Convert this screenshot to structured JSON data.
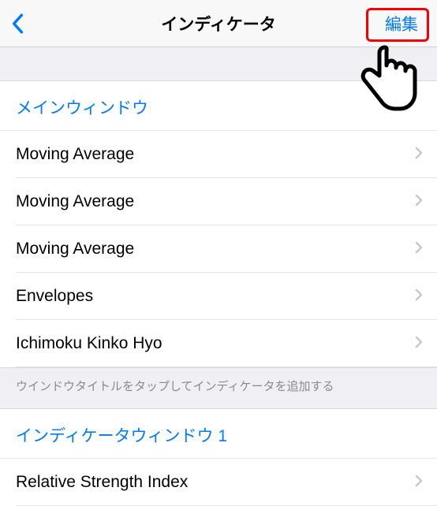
{
  "navbar": {
    "title": "インディケータ",
    "edit_label": "編集"
  },
  "main_section": {
    "header": "メインウィンドウ",
    "items": [
      {
        "label": "Moving Average"
      },
      {
        "label": "Moving Average"
      },
      {
        "label": "Moving Average"
      },
      {
        "label": "Envelopes"
      },
      {
        "label": "Ichimoku Kinko Hyo"
      }
    ],
    "footer": "ウインドウタイトルをタップしてインディケータを追加する"
  },
  "indicator_window_1": {
    "header": "インディケータウィンドウ 1",
    "items": [
      {
        "label": "Relative Strength Index"
      }
    ]
  },
  "colors": {
    "accent": "#007aff",
    "highlight": "#f80000"
  }
}
